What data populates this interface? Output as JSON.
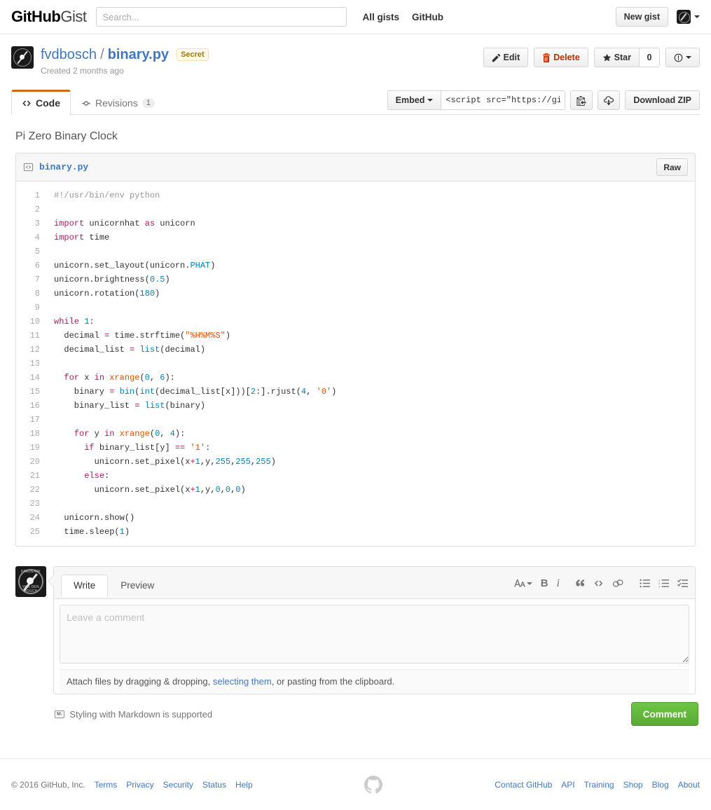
{
  "header": {
    "logo_bold": "GitHub",
    "logo_light": "Gist",
    "search_placeholder": "Search...",
    "nav": [
      {
        "label": "All gists",
        "name": "nav-all-gists"
      },
      {
        "label": "GitHub",
        "name": "nav-github"
      }
    ],
    "new_gist_label": "New gist",
    "user_avatar_icon": "user-avatar-icon",
    "user_menu_caret": "chevron-down-icon"
  },
  "gist": {
    "owner": "fvdbosch",
    "separator": "/",
    "filename": "binary.py",
    "visibility_label": "Secret",
    "created_text": "Created 2 months ago",
    "description": "Pi Zero Binary Clock",
    "actions": {
      "edit_label": "Edit",
      "delete_label": "Delete",
      "star_label": "Star",
      "star_count": "0",
      "report_icon": "alert-icon"
    },
    "tabs": [
      {
        "label": "Code",
        "icon": "code-icon",
        "count": null,
        "selected": true
      },
      {
        "label": "Revisions",
        "icon": "git-commit-icon",
        "count": "1",
        "selected": false
      }
    ],
    "embed": {
      "button_label": "Embed",
      "value": "<script src=\"https://gi",
      "copy_icon": "clippy-icon",
      "download_icon": "cloud-download-icon",
      "download_zip_label": "Download ZIP"
    }
  },
  "file": {
    "icon": "file-code-icon",
    "name": "binary.py",
    "raw_label": "Raw",
    "lines": [
      {
        "n": "1",
        "html": "<span class=\"c\">#!/usr/bin/env python</span>"
      },
      {
        "n": "2",
        "html": ""
      },
      {
        "n": "3",
        "html": "<span class=\"k\">import</span> unicornhat <span class=\"k\">as</span> unicorn"
      },
      {
        "n": "4",
        "html": "<span class=\"k\">import</span> time"
      },
      {
        "n": "5",
        "html": ""
      },
      {
        "n": "6",
        "html": "unicorn.set_layout(unicorn.<span class=\"n\">PHAT</span>)"
      },
      {
        "n": "7",
        "html": "unicorn.brightness(<span class=\"n\">0.5</span>)"
      },
      {
        "n": "8",
        "html": "unicorn.rotation(<span class=\"n\">180</span>)"
      },
      {
        "n": "9",
        "html": ""
      },
      {
        "n": "10",
        "html": "<span class=\"k\">while</span> <span class=\"n\">1</span>:"
      },
      {
        "n": "11",
        "html": "  decimal <span class=\"o\">=</span> time.strftime(<span class=\"s\">\"%H%M%S\"</span>)"
      },
      {
        "n": "12",
        "html": "  decimal_list <span class=\"o\">=</span> <span class=\"bi\">list</span>(decimal)"
      },
      {
        "n": "13",
        "html": ""
      },
      {
        "n": "14",
        "html": "  <span class=\"k\">for</span> x <span class=\"k\">in</span> <span class=\"s\">xrange</span>(<span class=\"n\">0</span>, <span class=\"n\">6</span>):"
      },
      {
        "n": "15",
        "html": "    binary <span class=\"o\">=</span> <span class=\"bi\">bin</span>(<span class=\"bi\">int</span>(decimal_list[x]))[<span class=\"n\">2</span>:].rjust(<span class=\"n\">4</span>, <span class=\"s\">'0'</span>)"
      },
      {
        "n": "16",
        "html": "    binary_list <span class=\"o\">=</span> <span class=\"bi\">list</span>(binary)"
      },
      {
        "n": "17",
        "html": ""
      },
      {
        "n": "18",
        "html": "    <span class=\"k\">for</span> y <span class=\"k\">in</span> <span class=\"s\">xrange</span>(<span class=\"n\">0</span>, <span class=\"n\">4</span>):"
      },
      {
        "n": "19",
        "html": "      <span class=\"k\">if</span> binary_list[y] <span class=\"o\">==</span> <span class=\"s\">'1'</span>:"
      },
      {
        "n": "20",
        "html": "        unicorn.set_pixel(x<span class=\"o\">+</span><span class=\"n\">1</span>,y,<span class=\"n\">255</span>,<span class=\"n\">255</span>,<span class=\"n\">255</span>)"
      },
      {
        "n": "21",
        "html": "      <span class=\"k\">else</span>:"
      },
      {
        "n": "22",
        "html": "        unicorn.set_pixel(x<span class=\"o\">+</span><span class=\"n\">1</span>,y,<span class=\"n\">0</span>,<span class=\"n\">0</span>,<span class=\"n\">0</span>)"
      },
      {
        "n": "23",
        "html": ""
      },
      {
        "n": "24",
        "html": "  unicorn.show()"
      },
      {
        "n": "25",
        "html": "  time.sleep(<span class=\"n\">1</span>)"
      }
    ]
  },
  "comment_form": {
    "avatar_icon": "user-avatar-icon",
    "avatar_text_top": "FREDERIK",
    "avatar_text_bottom": "VAN DEN BOSCH",
    "tabs": [
      {
        "label": "Write",
        "selected": true
      },
      {
        "label": "Preview",
        "selected": false
      }
    ],
    "toolbar": [
      {
        "name": "text-size-icon",
        "glyph": "AA"
      },
      {
        "name": "bold-icon",
        "glyph": "B"
      },
      {
        "name": "italic-icon",
        "glyph": "i"
      },
      {
        "name": "quote-icon",
        "glyph": "“"
      },
      {
        "name": "code-icon",
        "glyph": "<>"
      },
      {
        "name": "link-icon",
        "glyph": "∞"
      },
      {
        "name": "unordered-list-icon",
        "glyph": "☰"
      },
      {
        "name": "ordered-list-icon",
        "glyph": "≣"
      },
      {
        "name": "task-list-icon",
        "glyph": "✓"
      }
    ],
    "textarea_placeholder": "Leave a comment",
    "textarea_value": "",
    "attach_prefix": "Attach files by dragging & dropping, ",
    "attach_link": "selecting them",
    "attach_suffix": ", or pasting from the clipboard.",
    "markdown_note": "Styling with Markdown is supported",
    "markdown_logo": "M↓",
    "submit_label": "Comment",
    "submit_color": "#6cc644"
  },
  "footer": {
    "copyright": "© 2016 GitHub, Inc.",
    "left_links": [
      "Terms",
      "Privacy",
      "Security",
      "Status",
      "Help"
    ],
    "mark_icon": "github-mark-icon",
    "right_links": [
      "Contact GitHub",
      "API",
      "Training",
      "Shop",
      "Blog",
      "About"
    ]
  },
  "colors": {
    "link": "#4078c0",
    "tab_accent": "#d26911",
    "danger": "#bd2c00",
    "secret_bg": "#fff9ea"
  }
}
